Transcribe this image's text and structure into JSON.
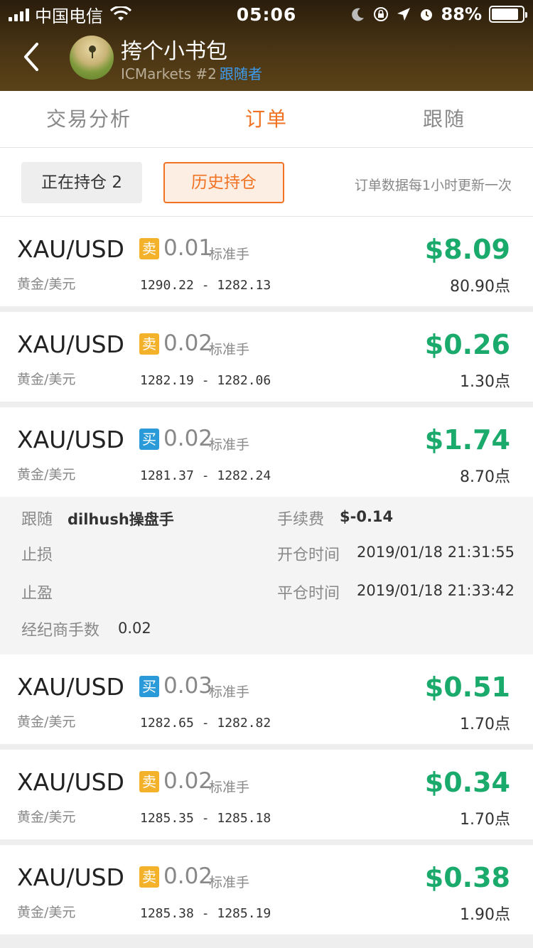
{
  "status_bar": {
    "carrier": "中国电信",
    "time": "05:06",
    "battery": "88%",
    "battery_level": 0.88
  },
  "header": {
    "trader_name": "挎个小书包",
    "broker": "ICMarkets #2",
    "follow_label": "跟随者"
  },
  "tabs": [
    {
      "label": "交易分析",
      "active": false
    },
    {
      "label": "订单",
      "active": true
    },
    {
      "label": "跟随",
      "active": false
    }
  ],
  "filters": {
    "open_positions": "正在持仓 2",
    "history_positions": "历史持仓",
    "update_note": "订单数据每1小时更新一次"
  },
  "orders": [
    {
      "symbol": "XAU/USD",
      "symbol_cn": "黄金/美元",
      "side": "卖",
      "side_type": "sell",
      "lot": "0.01",
      "lot_unit": "标准手",
      "prices": "1290.22 - 1282.13",
      "profit": "$8.09",
      "points": "80.90点"
    },
    {
      "symbol": "XAU/USD",
      "symbol_cn": "黄金/美元",
      "side": "卖",
      "side_type": "sell",
      "lot": "0.02",
      "lot_unit": "标准手",
      "prices": "1282.19 - 1282.06",
      "profit": "$0.26",
      "points": "1.30点"
    },
    {
      "symbol": "XAU/USD",
      "symbol_cn": "黄金/美元",
      "side": "买",
      "side_type": "buy",
      "lot": "0.02",
      "lot_unit": "标准手",
      "prices": "1281.37 - 1282.24",
      "profit": "$1.74",
      "points": "8.70点"
    },
    {
      "symbol": "XAU/USD",
      "symbol_cn": "黄金/美元",
      "side": "买",
      "side_type": "buy",
      "lot": "0.03",
      "lot_unit": "标准手",
      "prices": "1282.65 - 1282.82",
      "profit": "$0.51",
      "points": "1.70点"
    },
    {
      "symbol": "XAU/USD",
      "symbol_cn": "黄金/美元",
      "side": "卖",
      "side_type": "sell",
      "lot": "0.02",
      "lot_unit": "标准手",
      "prices": "1285.35 - 1285.18",
      "profit": "$0.34",
      "points": "1.70点"
    },
    {
      "symbol": "XAU/USD",
      "symbol_cn": "黄金/美元",
      "side": "卖",
      "side_type": "sell",
      "lot": "0.02",
      "lot_unit": "标准手",
      "prices": "1285.38 - 1285.19",
      "profit": "$0.38",
      "points": "1.90点"
    }
  ],
  "detail": {
    "follow_label": "跟随",
    "follow_value": "dilhush操盘手",
    "fee_label": "手续费",
    "fee_value": "$-0.14",
    "stop_loss_label": "止损",
    "open_time_label": "开仓时间",
    "open_time_value": "2019/01/18 21:31:55",
    "take_profit_label": "止盈",
    "close_time_label": "平仓时间",
    "close_time_value": "2019/01/18 21:33:42",
    "broker_lots_label": "经纪商手数",
    "broker_lots_value": "0.02"
  },
  "colors": {
    "accent": "#f07222",
    "profit": "#1aaa6c",
    "sell": "#f4b22a",
    "buy": "#2a9ad8",
    "link": "#3b9cf2"
  }
}
